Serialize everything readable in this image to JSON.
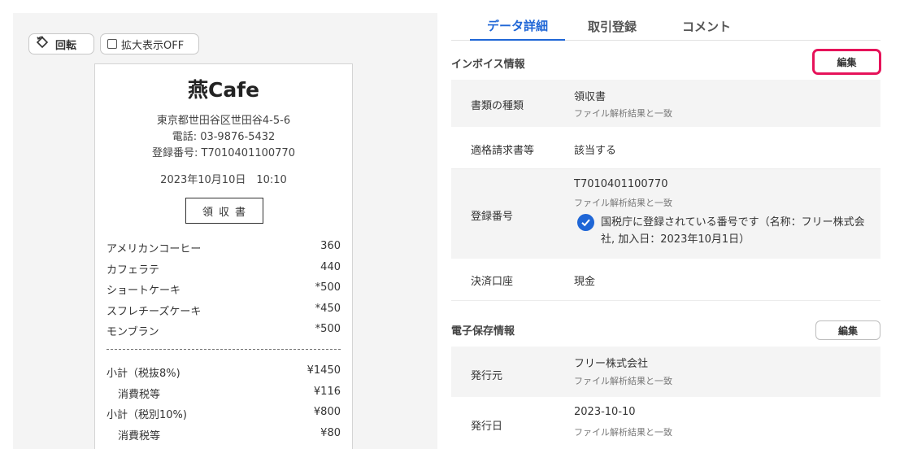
{
  "viewer": {
    "rotate_label": "回転",
    "zoom_label": "拡大表示OFF"
  },
  "receipt": {
    "store_name": "燕Cafe",
    "address": "東京都世田谷区世田谷4-5-6",
    "phone": "電話: 03-9876-5432",
    "registration": "登録番号: T7010401100770",
    "datetime": "2023年10月10日　10:10",
    "title": "領収書",
    "items": [
      {
        "name": "アメリカンコーヒー",
        "price": "360"
      },
      {
        "name": "カフェラテ",
        "price": "440"
      },
      {
        "name": "ショートケーキ",
        "price": "*500"
      },
      {
        "name": "スフレチーズケーキ",
        "price": "*450"
      },
      {
        "name": "モンブラン",
        "price": "*500"
      }
    ],
    "totals": [
      {
        "name": "小計（税抜8%)",
        "price": "¥1450"
      },
      {
        "name": "消費税等",
        "price": "¥116"
      },
      {
        "name": "小計（税別10%)",
        "price": "¥800"
      },
      {
        "name": "消費税等",
        "price": "¥80"
      }
    ]
  },
  "tabs": [
    "データ詳細",
    "取引登録",
    "コメント"
  ],
  "invoice": {
    "section_title": "インボイス情報",
    "edit_label": "編集",
    "doc_type_label": "書類の種類",
    "doc_type_value": "領収書",
    "doc_type_note": "ファイル解析結果と一致",
    "qualified_label": "適格請求書等",
    "qualified_value": "該当する",
    "reg_label": "登録番号",
    "reg_value": "T7010401100770",
    "reg_note": "ファイル解析結果と一致",
    "reg_verified": "国税庁に登録されている番号です（名称：フリー株式会社, 加入日：2023年10月1日）",
    "account_label": "決済口座",
    "account_value": "現金"
  },
  "estorage": {
    "section_title": "電子保存情報",
    "edit_label": "編集",
    "issuer_label": "発行元",
    "issuer_value": "フリー株式会社",
    "issuer_note": "ファイル解析結果と一致",
    "date_label": "発行日",
    "date_value": "2023-10-10",
    "date_note": "ファイル解析結果と一致"
  },
  "colors": {
    "accent": "#1f66d6",
    "highlight": "#e6135a"
  }
}
